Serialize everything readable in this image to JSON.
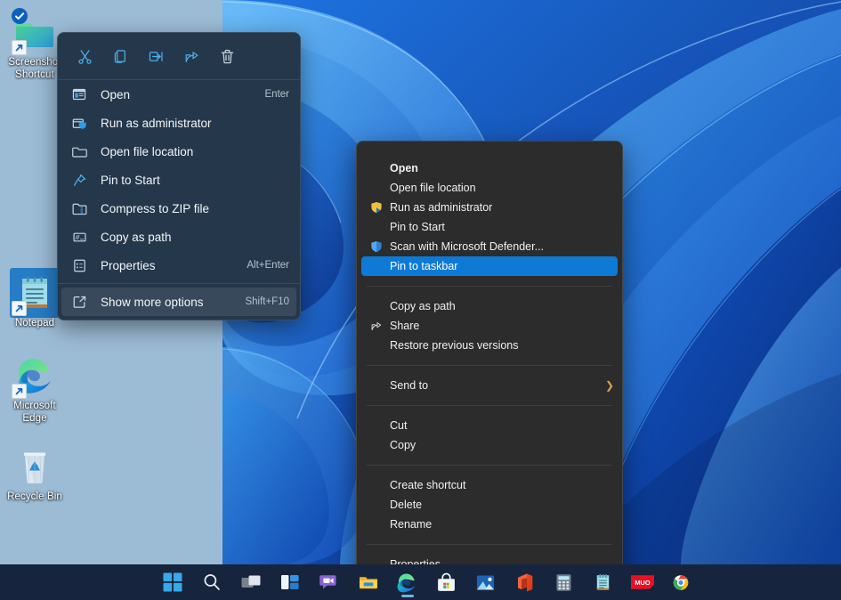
{
  "desktop": {
    "icons": [
      {
        "name": "Screenshot Shortcut",
        "label_line1": "Screenshot",
        "label_line2": "Shortcut",
        "icon": "folder-icon",
        "selected": false,
        "shortcut": true,
        "badge": "onedrive-synced-badge"
      },
      {
        "name": "Notepad",
        "label_line1": "Notepad",
        "label_line2": "",
        "icon": "notepad-icon",
        "selected": true,
        "shortcut": true,
        "badge": ""
      },
      {
        "name": "Microsoft Edge",
        "label_line1": "Microsoft",
        "label_line2": "Edge",
        "icon": "edge-icon",
        "selected": false,
        "shortcut": true,
        "badge": ""
      },
      {
        "name": "Recycle Bin",
        "label_line1": "Recycle Bin",
        "label_line2": "",
        "icon": "recycle-bin-icon",
        "selected": false,
        "shortcut": false,
        "badge": ""
      }
    ]
  },
  "context_menu": {
    "toolbar": [
      {
        "name": "cut-icon",
        "tooltip": "Cut"
      },
      {
        "name": "copy-icon",
        "tooltip": "Copy"
      },
      {
        "name": "rename-icon",
        "tooltip": "Rename"
      },
      {
        "name": "share-icon",
        "tooltip": "Share"
      },
      {
        "name": "delete-icon",
        "tooltip": "Delete"
      }
    ],
    "items": [
      {
        "label": "Open",
        "accel": "Enter",
        "icon": "open-window-icon",
        "highlighted": false
      },
      {
        "label": "Run as administrator",
        "accel": "",
        "icon": "shield-admin-icon",
        "highlighted": false
      },
      {
        "label": "Open file location",
        "accel": "",
        "icon": "folder-open-icon",
        "highlighted": false
      },
      {
        "label": "Pin to Start",
        "accel": "",
        "icon": "pin-icon",
        "highlighted": false
      },
      {
        "label": "Compress to ZIP file",
        "accel": "",
        "icon": "zip-icon",
        "highlighted": false
      },
      {
        "label": "Copy as path",
        "accel": "",
        "icon": "copy-path-icon",
        "highlighted": false
      },
      {
        "label": "Properties",
        "accel": "Alt+Enter",
        "icon": "properties-icon",
        "highlighted": false
      }
    ],
    "more_options": {
      "label": "Show more options",
      "accel": "Shift+F10",
      "icon": "show-more-options-icon",
      "highlighted": true
    }
  },
  "classic_menu": {
    "group1": [
      {
        "label": "Open",
        "icon": "",
        "bold": true,
        "selected": false,
        "submenu": false
      },
      {
        "label": "Open file location",
        "icon": "",
        "bold": false,
        "selected": false,
        "submenu": false
      },
      {
        "label": "Run as administrator",
        "icon": "uac-shield-icon",
        "bold": false,
        "selected": false,
        "submenu": false
      },
      {
        "label": "Pin to Start",
        "icon": "",
        "bold": false,
        "selected": false,
        "submenu": false
      },
      {
        "label": "Scan with Microsoft Defender...",
        "icon": "defender-shield-icon",
        "bold": false,
        "selected": false,
        "submenu": false
      },
      {
        "label": "Pin to taskbar",
        "icon": "",
        "bold": false,
        "selected": true,
        "submenu": false
      }
    ],
    "group2": [
      {
        "label": "Copy as path",
        "icon": "",
        "bold": false,
        "selected": false,
        "submenu": false
      },
      {
        "label": "Share",
        "icon": "share-arrow-icon",
        "bold": false,
        "selected": false,
        "submenu": false
      },
      {
        "label": "Restore previous versions",
        "icon": "",
        "bold": false,
        "selected": false,
        "submenu": false
      }
    ],
    "group3": [
      {
        "label": "Send to",
        "icon": "",
        "bold": false,
        "selected": false,
        "submenu": true
      }
    ],
    "group4": [
      {
        "label": "Cut",
        "icon": "",
        "bold": false,
        "selected": false,
        "submenu": false
      },
      {
        "label": "Copy",
        "icon": "",
        "bold": false,
        "selected": false,
        "submenu": false
      }
    ],
    "group5": [
      {
        "label": "Create shortcut",
        "icon": "",
        "bold": false,
        "selected": false,
        "submenu": false
      },
      {
        "label": "Delete",
        "icon": "",
        "bold": false,
        "selected": false,
        "submenu": false
      },
      {
        "label": "Rename",
        "icon": "",
        "bold": false,
        "selected": false,
        "submenu": false
      }
    ],
    "group6": [
      {
        "label": "Properties",
        "icon": "",
        "bold": false,
        "selected": false,
        "submenu": false
      }
    ]
  },
  "taskbar": {
    "items": [
      {
        "name": "start-button",
        "label": "Start",
        "running": false
      },
      {
        "name": "search-button",
        "label": "Search",
        "running": false
      },
      {
        "name": "task-view-button",
        "label": "Task View",
        "running": false
      },
      {
        "name": "widgets-button",
        "label": "Widgets",
        "running": false
      },
      {
        "name": "chat-button",
        "label": "Chat",
        "running": false
      },
      {
        "name": "file-explorer-button",
        "label": "File Explorer",
        "running": false
      },
      {
        "name": "edge-button",
        "label": "Microsoft Edge",
        "running": true
      },
      {
        "name": "microsoft-store-button",
        "label": "Microsoft Store",
        "running": false
      },
      {
        "name": "photos-button",
        "label": "Photos",
        "running": false
      },
      {
        "name": "office-button",
        "label": "Office",
        "running": false
      },
      {
        "name": "calculator-button",
        "label": "Calculator",
        "running": false
      },
      {
        "name": "notepad-button",
        "label": "Notepad",
        "running": false
      },
      {
        "name": "muo-button",
        "label": "MUO",
        "running": false
      },
      {
        "name": "chrome-button",
        "label": "Google Chrome",
        "running": false
      }
    ]
  },
  "colors": {
    "accent": "#0d7ad6",
    "menu_bg": "#25384b",
    "classic_menu_bg": "#2c2c2c",
    "taskbar_bg": "#17243d",
    "desktop_left": "#9cbcd6"
  }
}
